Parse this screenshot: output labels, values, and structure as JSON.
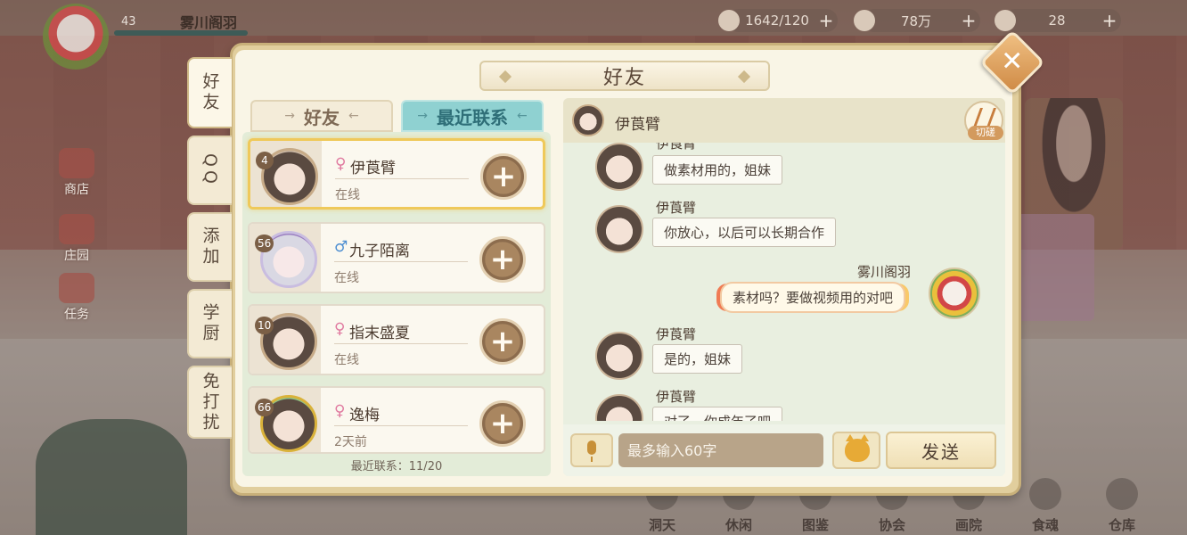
{
  "hud": {
    "level": "43",
    "player_name": "雾川阁羽",
    "resources": [
      {
        "icon": "stamina-icon",
        "value": "1642/120"
      },
      {
        "icon": "coin-icon",
        "value": "78万"
      },
      {
        "icon": "gem-icon",
        "value": "28"
      }
    ]
  },
  "side_menu": [
    {
      "icon": "shop-icon",
      "label": "商店"
    },
    {
      "icon": "manor-icon",
      "label": "庄园"
    },
    {
      "icon": "task-icon",
      "label": "任务"
    }
  ],
  "bottom_nav": [
    {
      "icon": "cave-icon",
      "label": "洞天"
    },
    {
      "icon": "leisure-icon",
      "label": "休闲"
    },
    {
      "icon": "atlas-icon",
      "label": "图鉴"
    },
    {
      "icon": "guild-icon",
      "label": "协会"
    },
    {
      "icon": "academy-icon",
      "label": "画院"
    },
    {
      "icon": "food-soul-icon",
      "label": "食魂"
    },
    {
      "icon": "warehouse-icon",
      "label": "仓库"
    }
  ],
  "dialog": {
    "title": "好友",
    "side_tabs": [
      "好友",
      "QQ",
      "添加",
      "学厨",
      "免打扰"
    ],
    "sub_tabs": {
      "friends": "好友",
      "recent": "最近联系"
    },
    "friends": [
      {
        "level": "4",
        "gender": "female",
        "gender_symbol": "♀",
        "name": "伊莨臂",
        "status": "在线",
        "avatar_style": "brown"
      },
      {
        "level": "56",
        "gender": "male",
        "gender_symbol": "♂",
        "name": "九子陌离",
        "status": "在线",
        "avatar_style": "silver"
      },
      {
        "level": "10",
        "gender": "female",
        "gender_symbol": "♀",
        "name": "指末盛夏",
        "status": "在线",
        "avatar_style": "brown"
      },
      {
        "level": "66",
        "gender": "female",
        "gender_symbol": "♀",
        "name": "逸梅",
        "status": "2天前",
        "avatar_style": "flower"
      }
    ],
    "recent_count": "最近联系：11/20",
    "chat": {
      "partner_name": "伊莨臂",
      "cut_label": "切磋",
      "messages": [
        {
          "from": "other",
          "name": "伊莨臂",
          "text": "做素材用的，姐妹"
        },
        {
          "from": "other",
          "name": "伊莨臂",
          "text": "你放心，以后可以长期合作"
        },
        {
          "from": "me",
          "name": "雾川阁羽",
          "text": "素材吗？要做视频用的对吧"
        },
        {
          "from": "other",
          "name": "伊莨臂",
          "text": "是的，姐妹"
        },
        {
          "from": "other",
          "name": "伊莨臂",
          "text": "对了，你成年了吧"
        }
      ],
      "input_placeholder": "最多输入60字",
      "send_label": "发送"
    }
  },
  "colors": {
    "panel_bg": "#f9f5e6",
    "recent_tab": "#8fd1d1",
    "female": "#e07aa0",
    "male": "#4d8ed1",
    "selected_border": "#efc95a"
  }
}
